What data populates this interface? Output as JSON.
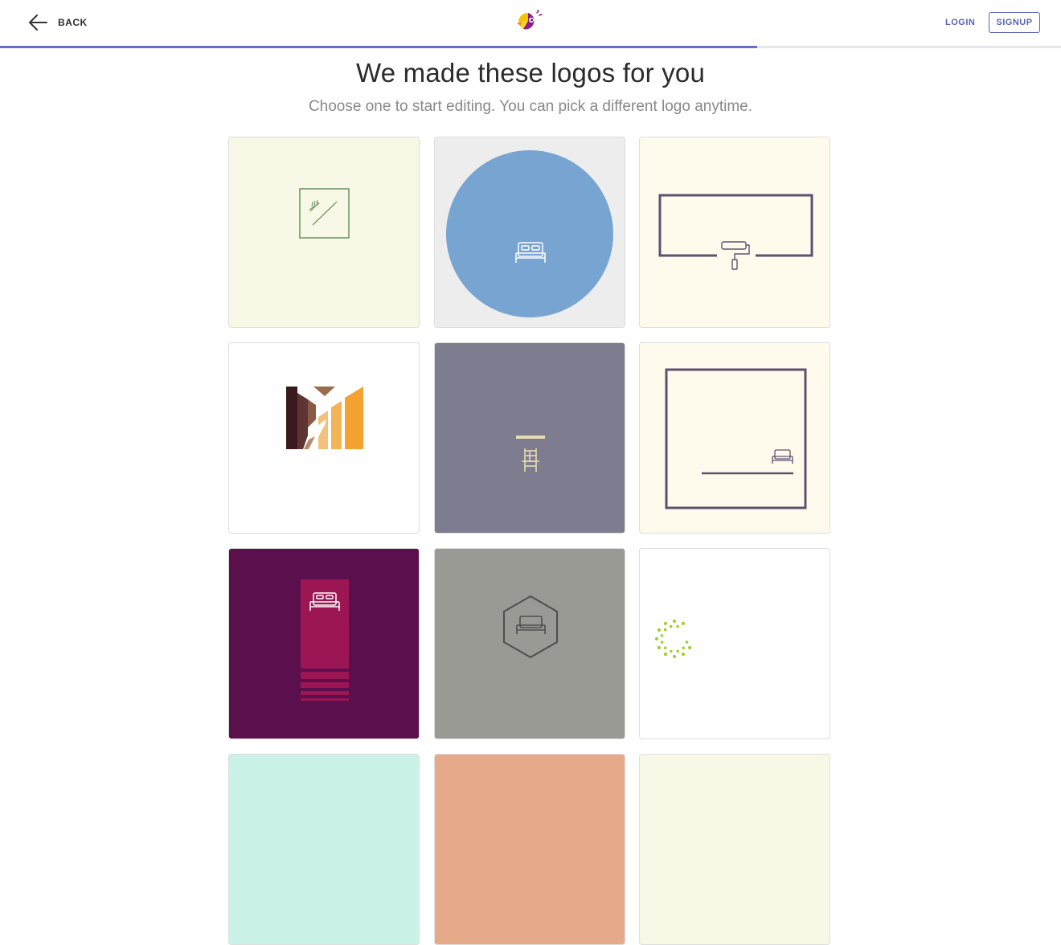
{
  "header": {
    "back_label": "BACK",
    "login_label": "LOGIN",
    "signup_label": "SIGNUP",
    "progress_fraction": 0.714
  },
  "main": {
    "title": "We made these logos for you",
    "subtitle": "Choose one to start editing. You can pick a different logo anytime."
  },
  "tiles": [
    {
      "icon": "tools-icon",
      "background": "#f7f9e6",
      "accent": "#5e8a5a"
    },
    {
      "icon": "bed-icon",
      "background": "#ededed",
      "accent": "#78a4d2"
    },
    {
      "icon": "paint-roller-icon",
      "background": "#fefbec",
      "accent": "#5e5170"
    },
    {
      "icon": "stripes-m-icon",
      "background": "#ffffff",
      "accent": "#f4a333"
    },
    {
      "icon": "chair-icon",
      "background": "#7e7c8f",
      "accent": "#e7dcb4"
    },
    {
      "icon": "bed-icon",
      "background": "#fefbec",
      "accent": "#5e5170"
    },
    {
      "icon": "bed-icon",
      "background": "#5b0f4c",
      "accent": "#9c1654"
    },
    {
      "icon": "hexagon-bed-icon",
      "background": "#9a9a94",
      "accent": "#4e4e4e"
    },
    {
      "icon": "loading-spinner-icon",
      "background": "#ffffff",
      "accent": "#9cd12a"
    },
    {
      "icon": "",
      "background": "#cbf2e6",
      "accent": ""
    },
    {
      "icon": "",
      "background": "#e6a98a",
      "accent": ""
    },
    {
      "icon": "",
      "background": "#f7f9e6",
      "accent": ""
    }
  ]
}
